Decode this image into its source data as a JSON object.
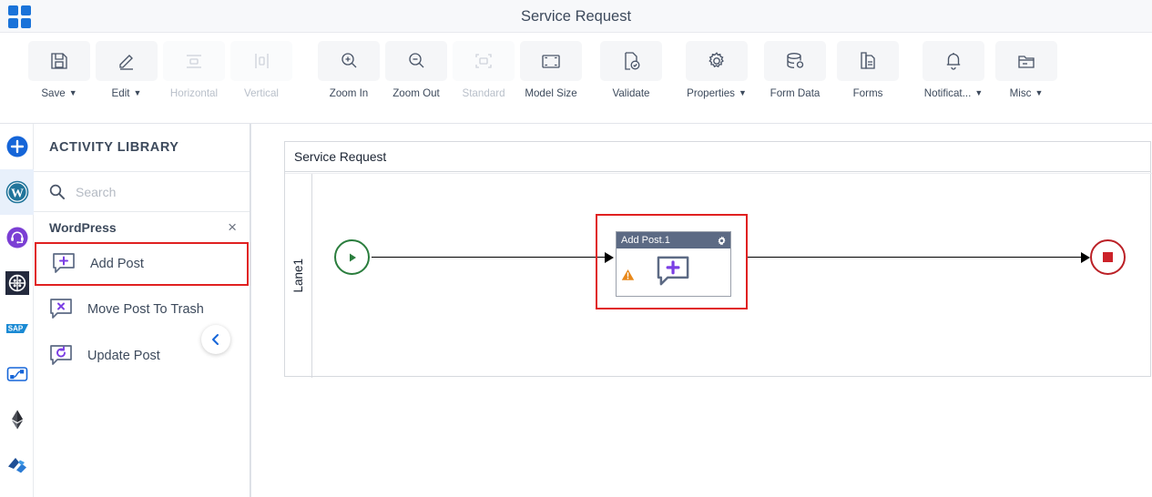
{
  "app": {
    "logo_icon": "grid-apps-icon",
    "title": "Service Request"
  },
  "toolbar": {
    "items": [
      {
        "label": "Save",
        "icon": "floppy-disk-icon",
        "caret": true,
        "disabled": false
      },
      {
        "label": "Edit",
        "icon": "pencil-icon",
        "caret": true,
        "disabled": false
      },
      {
        "label": "Horizontal",
        "icon": "horizontal-align-icon",
        "caret": false,
        "disabled": true
      },
      {
        "label": "Vertical",
        "icon": "vertical-align-icon",
        "caret": false,
        "disabled": true
      },
      {
        "label": "Zoom In",
        "icon": "zoom-in-icon",
        "caret": false,
        "disabled": false
      },
      {
        "label": "Zoom Out",
        "icon": "zoom-out-icon",
        "caret": false,
        "disabled": false
      },
      {
        "label": "Standard",
        "icon": "standard-size-icon",
        "caret": false,
        "disabled": true
      },
      {
        "label": "Model Size",
        "icon": "model-size-icon",
        "caret": false,
        "disabled": false
      },
      {
        "label": "Validate",
        "icon": "validate-doc-icon",
        "caret": false,
        "disabled": false
      },
      {
        "label": "Properties",
        "icon": "gear-icon",
        "caret": true,
        "disabled": false
      },
      {
        "label": "Form Data",
        "icon": "database-icon",
        "caret": false,
        "disabled": false
      },
      {
        "label": "Forms",
        "icon": "document-copy-icon",
        "caret": false,
        "disabled": false
      },
      {
        "label": "Notificat...",
        "icon": "bell-icon",
        "caret": true,
        "disabled": false
      },
      {
        "label": "Misc",
        "icon": "folder-icon",
        "caret": true,
        "disabled": false
      }
    ]
  },
  "rail": {
    "items": [
      {
        "name": "add-connector-icon",
        "selected": false
      },
      {
        "name": "wordpress-icon",
        "selected": true
      },
      {
        "name": "support-headset-icon",
        "selected": false
      },
      {
        "name": "dark-circle-grid-icon",
        "selected": false
      },
      {
        "name": "sap-icon",
        "selected": false
      },
      {
        "name": "workflow-node-icon",
        "selected": false
      },
      {
        "name": "ethereum-icon",
        "selected": false
      },
      {
        "name": "blue-shard-icon",
        "selected": false
      }
    ]
  },
  "panel": {
    "heading": "ACTIVITY LIBRARY",
    "search": {
      "value": "",
      "placeholder": "Search",
      "icon": "search-icon"
    },
    "group": {
      "name": "WordPress",
      "close_label": "×"
    },
    "activities": [
      {
        "label": "Add Post",
        "icon": "speech-plus-icon",
        "glyph": "+",
        "highlighted": true
      },
      {
        "label": "Move Post To Trash",
        "icon": "speech-cross-icon",
        "glyph": "×",
        "highlighted": false
      },
      {
        "label": "Update Post",
        "icon": "speech-refresh-icon",
        "glyph": "↻",
        "highlighted": false
      }
    ],
    "collapse_icon": "chevron-left-icon"
  },
  "canvas": {
    "pool_title": "Service Request",
    "lane_label": "Lane1",
    "start_event": {
      "name": "start-event",
      "icon": "play-triangle-icon",
      "color": "#2a7d3d"
    },
    "end_event": {
      "name": "end-event",
      "icon": "stop-square-icon",
      "color": "#cc2229"
    },
    "task": {
      "title": "Add Post.1",
      "gear_icon": "gear-icon",
      "warning_icon": "warning-triangle-icon",
      "body_icon": "speech-plus-icon",
      "glyph": "+",
      "selected": true,
      "header_color": "#5c6a84",
      "selection_color": "#e02020"
    }
  },
  "colors": {
    "accent_blue": "#1a73d9",
    "selection_red": "#e02020",
    "start_green": "#2a7d3d",
    "end_red": "#cc2229",
    "warning_orange": "#e8881a",
    "task_header": "#5c6a84",
    "wordpress_purple": "#7b3fe4"
  }
}
